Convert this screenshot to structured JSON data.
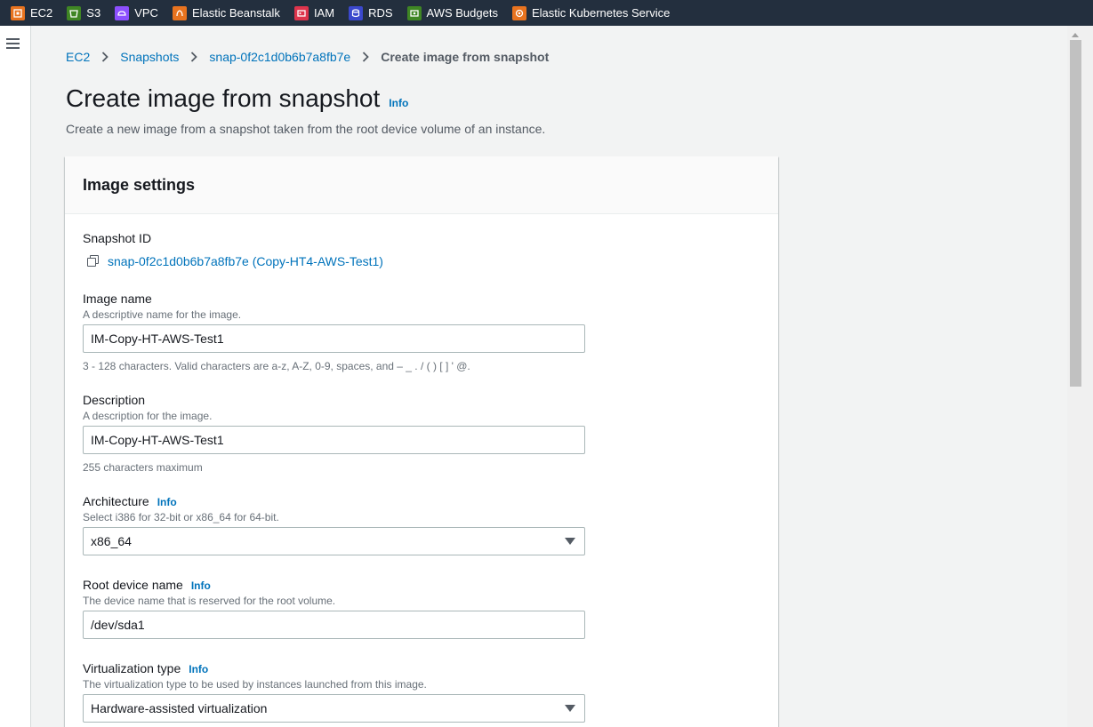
{
  "favorites": [
    {
      "label": "EC2",
      "icon": "ec2-icon",
      "color": "#e8731f"
    },
    {
      "label": "S3",
      "icon": "s3-icon",
      "color": "#3f8624"
    },
    {
      "label": "VPC",
      "icon": "vpc-icon",
      "color": "#8c4fff"
    },
    {
      "label": "Elastic Beanstalk",
      "icon": "beanstalk-icon",
      "color": "#e8731f"
    },
    {
      "label": "IAM",
      "icon": "iam-icon",
      "color": "#dd344c"
    },
    {
      "label": "RDS",
      "icon": "rds-icon",
      "color": "#3b48cc"
    },
    {
      "label": "AWS Budgets",
      "icon": "budgets-icon",
      "color": "#3f8624"
    },
    {
      "label": "Elastic Kubernetes Service",
      "icon": "eks-icon",
      "color": "#e8731f"
    }
  ],
  "breadcrumb": {
    "items": [
      "EC2",
      "Snapshots",
      "snap-0f2c1d0b6b7a8fb7e"
    ],
    "current": "Create image from snapshot"
  },
  "page": {
    "title": "Create image from snapshot",
    "info": "Info",
    "description": "Create a new image from a snapshot taken from the root device volume of an instance."
  },
  "panel": {
    "title": "Image settings",
    "snapshot": {
      "label": "Snapshot ID",
      "value": "snap-0f2c1d0b6b7a8fb7e (Copy-HT4-AWS-Test1)"
    },
    "image_name": {
      "label": "Image name",
      "description": "A descriptive name for the image.",
      "value": "IM-Copy-HT-AWS-Test1",
      "constraint": "3 - 128 characters. Valid characters are a-z, A-Z, 0-9, spaces, and – _ . / ( ) [ ] ' @."
    },
    "description_field": {
      "label": "Description",
      "description": "A description for the image.",
      "value": "IM-Copy-HT-AWS-Test1",
      "constraint": "255 characters maximum"
    },
    "architecture": {
      "label": "Architecture",
      "info": "Info",
      "description": "Select i386 for 32-bit or x86_64 for 64-bit.",
      "value": "x86_64"
    },
    "root_device": {
      "label": "Root device name",
      "info": "Info",
      "description": "The device name that is reserved for the root volume.",
      "value": "/dev/sda1"
    },
    "virtualization": {
      "label": "Virtualization type",
      "info": "Info",
      "description": "The virtualization type to be used by instances launched from this image.",
      "value": "Hardware-assisted virtualization"
    }
  }
}
